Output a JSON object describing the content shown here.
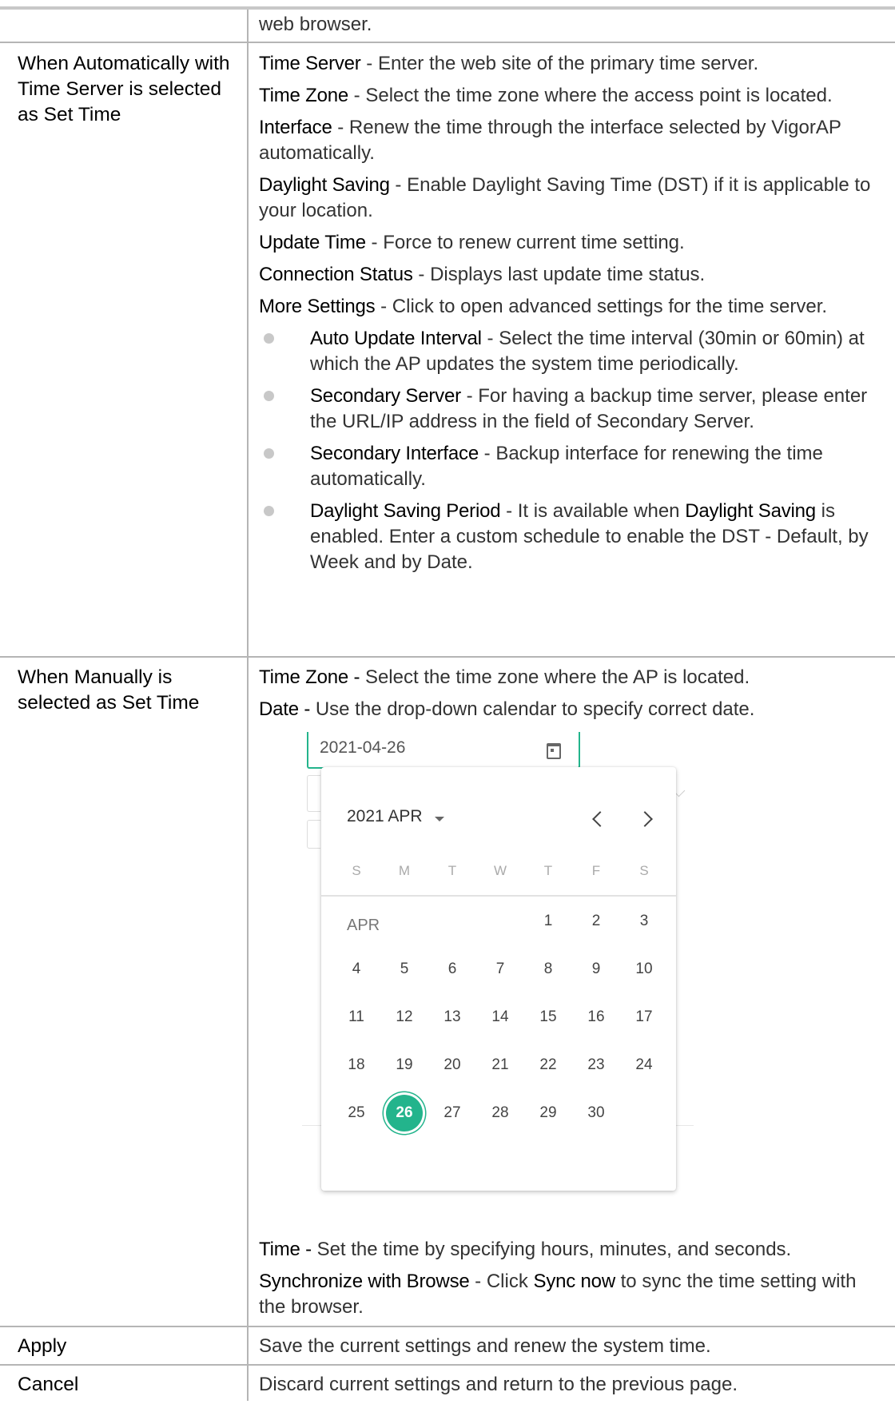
{
  "rows": [
    {
      "label": "",
      "paragraphs": [
        {
          "text": "web browser."
        }
      ]
    },
    {
      "label": "When Automatically with Time Server is selected as Set Time",
      "paragraphs": [
        {
          "term": "Time Server",
          "text": " - Enter the web site of the primary time server."
        },
        {
          "term": "Time Zone",
          "text": " - Select the time zone where the access point is located."
        },
        {
          "term": "Interface",
          "text": " - Renew the time through the interface selected by VigorAP automatically."
        },
        {
          "term": "Daylight Saving",
          "text": " - Enable Daylight Saving Time (DST) if it is applicable to your location."
        },
        {
          "term": "Update Time",
          "text": " - Force to renew current time setting."
        },
        {
          "term": "Connection Status",
          "text": " - Displays last update time status."
        },
        {
          "term": "More Settings",
          "text": " - Click to open advanced settings for the time server."
        }
      ],
      "bullets": [
        {
          "term": "Auto Update Interval",
          "text": " - Select the time interval (30min or 60min) at which the AP updates the system time periodically."
        },
        {
          "term": "Secondary Server",
          "text": " - For having a backup time server, please enter the URL/IP address in the field of Secondary Server."
        },
        {
          "term": "Secondary Interface",
          "text": " - Backup interface for renewing the time automatically."
        },
        {
          "term": "Daylight Saving Period",
          "text": " - It is available when ",
          "term2": "Daylight Saving",
          "text2": " is enabled. Enter a custom schedule to enable the DST - Default, by Week and by Date."
        }
      ]
    },
    {
      "label": "When Manually is selected as Set Time",
      "paragraphs": [
        {
          "term": "Time Zone -",
          "text": " Select the time zone where the AP is located."
        },
        {
          "term": "Date -",
          "text": " Use the drop-down calendar to specify correct date."
        }
      ],
      "after": [
        {
          "term": "Time -",
          "text": " Set the time by specifying hours, minutes, and seconds."
        },
        {
          "term": "Synchronize with Browse",
          "text": " - Click ",
          "term2": "Sync now",
          "text2": " to sync the time setting with the browser."
        }
      ]
    },
    {
      "label": "Apply",
      "paragraphs": [
        {
          "text": "Save the current settings and renew the system time."
        }
      ]
    },
    {
      "label": "Cancel",
      "paragraphs": [
        {
          "text": "Discard current settings and return to the previous page."
        }
      ]
    }
  ],
  "datepicker": {
    "value": "2021-04-26",
    "month_label": "2021 APR",
    "month_short": "APR",
    "weekdays": [
      "S",
      "M",
      "T",
      "W",
      "T",
      "F",
      "S"
    ],
    "first_day_weekday_index": 4,
    "days_in_month": 30,
    "selected_day": 26,
    "accent_color": "#23b48c"
  }
}
